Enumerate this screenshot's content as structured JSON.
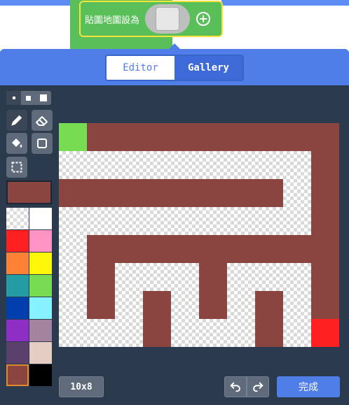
{
  "block": {
    "label": "貼圖地圖設為",
    "plus_icon": "plus-circle-icon"
  },
  "tabs": [
    {
      "label": "Editor",
      "active": true
    },
    {
      "label": "Gallery",
      "active": false
    }
  ],
  "tools": {
    "brush_sizes": [
      "small",
      "medium",
      "large"
    ],
    "selected_size": "small",
    "items": [
      "pencil",
      "eraser",
      "fill",
      "rectangle",
      "marquee-select"
    ],
    "active_tool": "pencil"
  },
  "selected_color": "#8b4540",
  "palette": [
    "transparent",
    "#ffffff",
    "#ff2121",
    "#ff93c4",
    "#ff8135",
    "#fff609",
    "#249ca3",
    "#78dc52",
    "#003fad",
    "#87f2ff",
    "#8e2ec4",
    "#a4839f",
    "#5c406c",
    "#e5cdc4",
    "#8b4540",
    "#000000"
  ],
  "canvas": {
    "width": 10,
    "height": 8,
    "colors": {
      "0": "empty",
      "1": "#8b4540",
      "2": "#78dc52",
      "3": "#ff2121"
    },
    "rows": [
      [
        2,
        1,
        1,
        1,
        1,
        1,
        1,
        1,
        1,
        1
      ],
      [
        0,
        0,
        0,
        0,
        0,
        0,
        0,
        0,
        0,
        1
      ],
      [
        1,
        1,
        1,
        1,
        1,
        1,
        1,
        1,
        0,
        1
      ],
      [
        0,
        0,
        0,
        0,
        0,
        0,
        0,
        0,
        0,
        1
      ],
      [
        0,
        1,
        1,
        1,
        1,
        1,
        1,
        1,
        1,
        1
      ],
      [
        0,
        1,
        0,
        0,
        0,
        1,
        0,
        0,
        0,
        1
      ],
      [
        0,
        1,
        0,
        1,
        0,
        1,
        0,
        1,
        0,
        1
      ],
      [
        0,
        0,
        0,
        1,
        0,
        0,
        0,
        1,
        0,
        3
      ]
    ]
  },
  "footer": {
    "size_label": "10x8",
    "done_label": "完成"
  }
}
